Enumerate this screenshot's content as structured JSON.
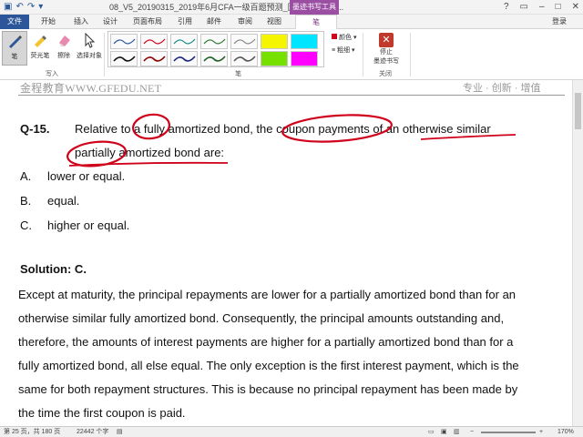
{
  "window": {
    "title": "08_V5_20190315_2019年6月CFA一级百题预测_固定收益（授...",
    "context_tab": "墨迹书写工具",
    "login_label": "登录"
  },
  "tabs": [
    "文件",
    "开始",
    "插入",
    "设计",
    "页面布局",
    "引用",
    "邮件",
    "审阅",
    "视图",
    "笔"
  ],
  "ribbon": {
    "tools": {
      "pen_label": "笔",
      "highlighter_label": "荧光笔",
      "eraser_label": "擦除",
      "select_label": "选择对象"
    },
    "group_write_label": "写入",
    "group_pen_label": "笔",
    "color_label": "颜色",
    "thickness_label": "粗细",
    "stop_label_line1": "停止",
    "stop_label_line2": "墨迹书写",
    "group_close_label": "关闭"
  },
  "document": {
    "header_left": "金程教育WWW.GFEDU.NET",
    "header_right": "专业 · 创新 · 增值",
    "question_number": "Q-15.",
    "question_line1": "Relative to a fully amortized bond, the coupon payments of an otherwise similar",
    "question_line2": "partially amortized bond are:",
    "options": [
      {
        "letter": "A.",
        "text": "lower or equal."
      },
      {
        "letter": "B.",
        "text": "equal."
      },
      {
        "letter": "C.",
        "text": "higher or equal."
      }
    ],
    "solution_title": "Solution: C.",
    "body_lines": [
      "Except at maturity, the principal repayments are lower for a partially amortized bond than for an",
      "otherwise similar fully amortized bond. Consequently, the principal amounts outstanding and,",
      "therefore, the amounts of interest payments are higher for a partially amortized bond than for a",
      "fully amortized bond, all else equal. The only exception is the first interest payment, which is the",
      "same for both repayment structures. This is because no principal repayment has been made by",
      "the time the first coupon is paid."
    ]
  },
  "status": {
    "page": "第 25 页，共 180 页",
    "words": "22442 个字",
    "zoom": "170%"
  },
  "colors": {
    "accent": "#2b579a",
    "ink_tools": "#9a4fa3",
    "ink": "#d0021b"
  }
}
